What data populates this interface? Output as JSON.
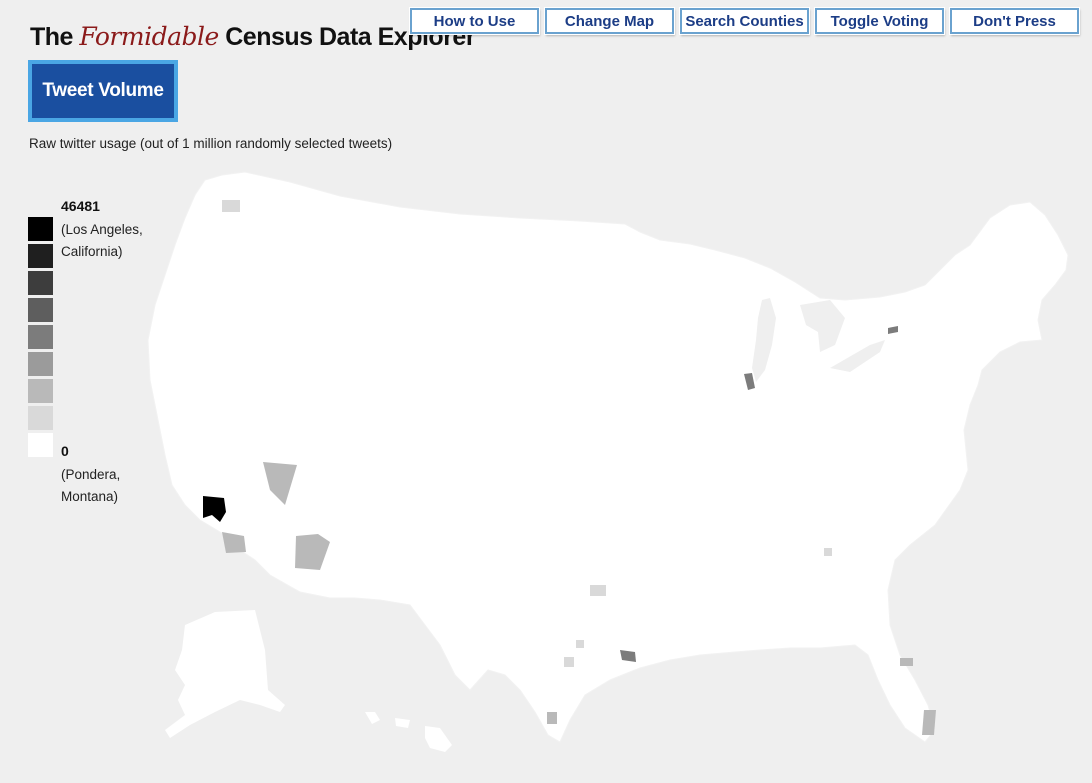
{
  "header": {
    "title_pre": "The ",
    "title_fancy": "Formidable",
    "title_post": " Census Data Explorer"
  },
  "nav": {
    "how_to_use": "How to Use",
    "change_map": "Change Map",
    "search_counties": "Search Counties",
    "toggle_voting": "Toggle Voting",
    "dont_press": "Don't Press"
  },
  "map_title_button": "Tweet Volume",
  "subtitle": "Raw twitter usage (out of 1 million randomly selected tweets)",
  "legend": {
    "max_value": "46481",
    "max_label": "(Los Angeles, California)",
    "min_value": "0",
    "min_label": "(Pondera, Montana)",
    "colors": [
      "#000000",
      "#1f1f1f",
      "#3d3d3d",
      "#5e5e5e",
      "#7c7c7c",
      "#9b9b9b",
      "#b9b9b9",
      "#d9d9d9",
      "#ffffff"
    ]
  },
  "colors": {
    "background": "#efefef",
    "land": "#ffffff",
    "accent_blue": "#1a4fa0",
    "title_red": "#8b1a1a"
  }
}
